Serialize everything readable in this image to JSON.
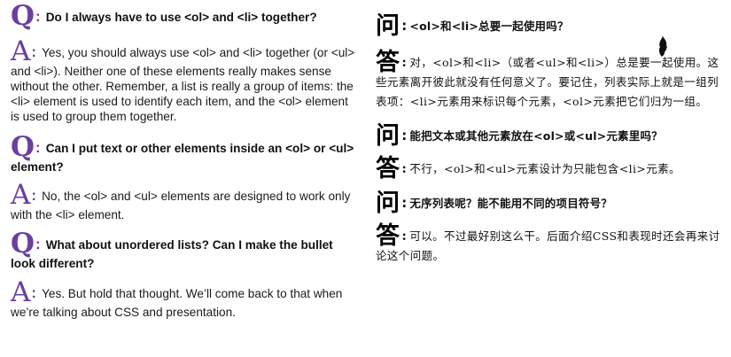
{
  "english": {
    "q_glyph": "Q",
    "a_glyph": "A",
    "colon": ":",
    "items": [
      {
        "question": "Do I always have to use <ol> and <li> together?",
        "answer": "Yes, you should always use <ol> and <li> together (or <ul> and <li>). Neither one of these elements really makes sense without the other. Remember, a list is really a group of items: the <li> element is used to identify each item, and the <ol> element is used to group them together."
      },
      {
        "question": "Can I put text or other elements inside an <ol> or <ul> element?",
        "answer": "No, the <ol> and <ul> elements are designed to work only with the <li> element."
      },
      {
        "question": "What about unordered lists? Can I make the bullet look different?",
        "answer": "Yes. But hold that thought. We’ll come back to that when we’re talking about CSS and presentation."
      }
    ]
  },
  "chinese": {
    "q_glyph": "问",
    "a_glyph": "答",
    "colon": ":",
    "items": [
      {
        "question": "<ol>和<li>总要一起使用吗？",
        "answer": "对，<ol>和<li>（或者<ul>和<li>）总是要一起使用。这些元素离开彼此就没有任何意义了。要记住，列表实际上就是一组列表项：<li>元素用来标识每个元素，<ol>元素把它们归为一组。"
      },
      {
        "question": "能把文本或其他元素放在<ol>或<ul>元素里吗？",
        "answer": "不行，<ol>和<ul>元素设计为只能包含<li>元素。"
      },
      {
        "question": "无序列表呢？能不能用不同的项目符号？",
        "answer": "可以。不过最好别这么干。后面介绍CSS和表现时还会再来讨论这个问题。"
      }
    ]
  },
  "colors": {
    "accent": "#6a3fa0",
    "text": "#111111"
  }
}
